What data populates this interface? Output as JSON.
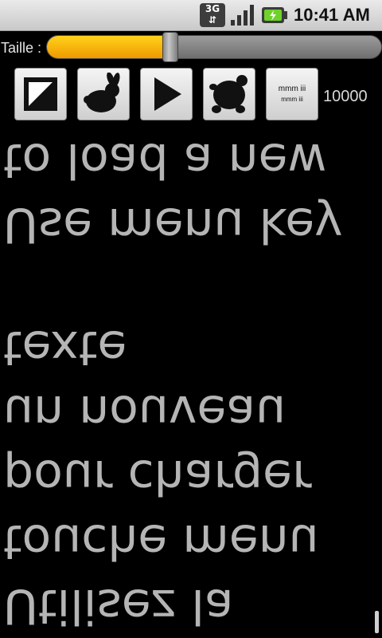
{
  "status_bar": {
    "network_type": "3G",
    "time": "10:41 AM",
    "icons": [
      "network-3g-icon",
      "signal-strength-icon",
      "battery-charging-icon"
    ]
  },
  "size_control": {
    "label": "Taille :",
    "value_fraction": 0.37
  },
  "toolbar": {
    "buttons": [
      "mirror-toggle-icon",
      "rabbit-fast-icon",
      "play-icon",
      "turtle-slow-icon",
      "text-format-button"
    ],
    "format_line1": "mmm iii",
    "format_line2": "mmm iii",
    "counter": "10000"
  },
  "text_lines": [
    "Utilisez la",
    "touche menu",
    "pour charger",
    "un nouveau",
    "texte",
    "",
    "Use menu key",
    "to load a new"
  ],
  "colors": {
    "background": "#000000",
    "slider_fill": "#f5b40a",
    "text": "#b5b5b5"
  }
}
